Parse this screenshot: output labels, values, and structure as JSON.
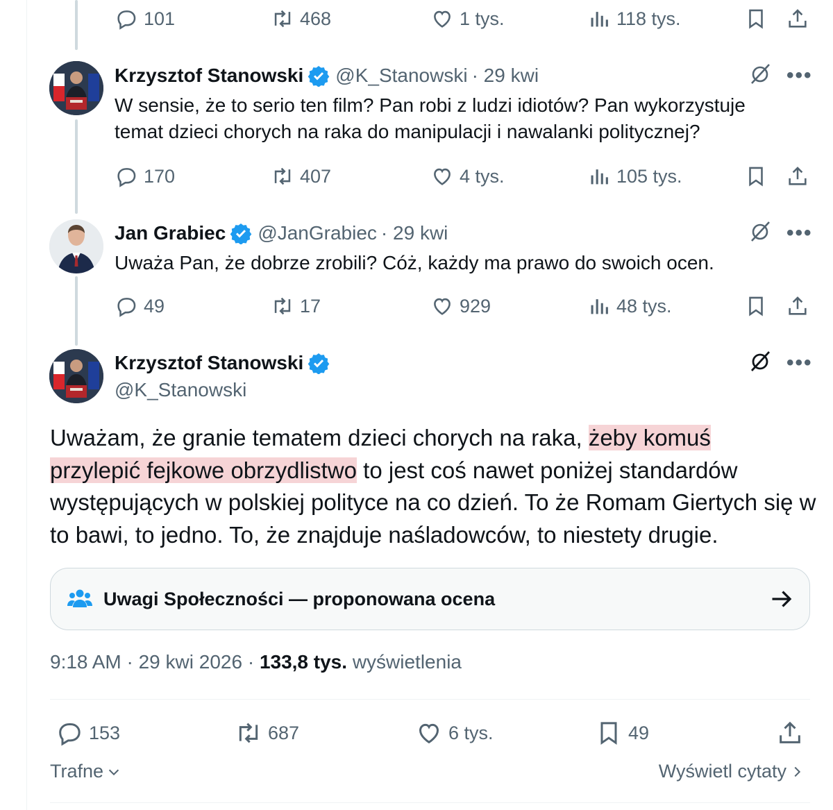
{
  "colors": {
    "accent": "#1d9bf0",
    "text": "#0f1419",
    "muted": "#536471",
    "highlight": "#f6d4d6"
  },
  "tweets": [
    {
      "stats": {
        "replies": "101",
        "retweets": "468",
        "likes": "1 tys.",
        "views": "118 tys."
      }
    },
    {
      "name": "Krzysztof Stanowski",
      "handle": "@K_Stanowski",
      "date": "· 29 kwi",
      "text_line1": "W sensie, że to serio ten film? Pan robi z ludzi idiotów? Pan wykorzystuje",
      "text_line2": "temat dzieci chorych na raka do manipulacji i nawalanki politycznej?",
      "stats": {
        "replies": "170",
        "retweets": "407",
        "likes": "4 tys.",
        "views": "105 tys."
      }
    },
    {
      "name": "Jan Grabiec",
      "handle": "@JanGrabiec",
      "date": "· 29 kwi",
      "text_line1": "Uważa Pan, że dobrze zrobili? Cóż, każdy ma prawo do swoich ocen.",
      "stats": {
        "replies": "49",
        "retweets": "17",
        "likes": "929",
        "views": "48 tys."
      }
    }
  ],
  "main_tweet": {
    "name": "Krzysztof Stanowski",
    "handle": "@K_Stanowski",
    "text_part1": "Uważam, że granie tematem dzieci chorych na raka, ",
    "text_highlight1": "żeby komuś ",
    "text_highlight2": "przylepić fejkowe obrzydlistwo",
    "text_part2": " to jest coś nawet poniżej standardów występujących w polskiej polityce na co dzień. To że Romam Giertych się w to bawi, to jedno. To, że znajduje naśladowców, to niestety drugie.",
    "community_note": "Uwagi Społeczności — proponowana ocena",
    "time": "9:18 AM · 29 kwi 2026 · ",
    "views_count": "133,8 tys.",
    "views_label": " wyświetlenia",
    "stats": {
      "replies": "153",
      "retweets": "687",
      "likes": "6 tys.",
      "bookmarks": "49"
    },
    "sort_label": "Trafne",
    "quotes_label": "Wyświetl cytaty"
  },
  "icons": [
    "reply-icon",
    "retweet-icon",
    "like-icon",
    "views-icon",
    "bookmark-icon",
    "share-icon",
    "verified-icon",
    "grok-icon",
    "more-icon",
    "community-icon",
    "arrow-right-icon",
    "chevron-down-icon",
    "chevron-right-icon"
  ]
}
